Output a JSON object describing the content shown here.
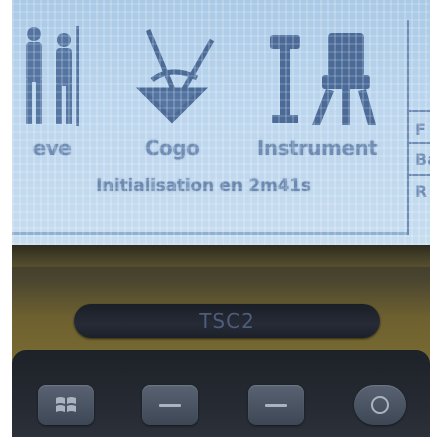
{
  "screen": {
    "tiles": [
      {
        "label": "eve"
      },
      {
        "label": "Cogo"
      },
      {
        "label": "Instrument"
      }
    ],
    "right_panel": {
      "letters": [
        "F",
        "Ba",
        "R"
      ]
    },
    "status": "Initialisation en 2m41s"
  },
  "device": {
    "model": "TSC2"
  },
  "softkeys": [
    {
      "icon": "windows-logo-icon"
    },
    {
      "icon": "dash-icon"
    },
    {
      "icon": "dash-icon"
    },
    {
      "icon": "ok-icon"
    }
  ],
  "colors": {
    "screen_text": "#6f8db4",
    "housing": "#8a7a34",
    "keypad": "#2b3039"
  }
}
